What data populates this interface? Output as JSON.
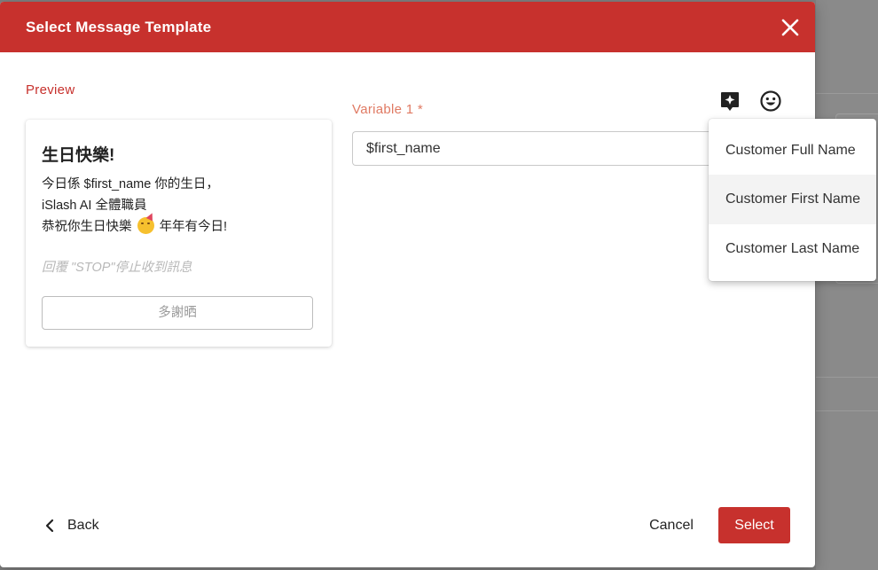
{
  "dialog": {
    "title": "Select Message Template"
  },
  "preview": {
    "label": "Preview",
    "card": {
      "title": "生日快樂!",
      "line1": "今日係 $first_name 你的生日，",
      "line2": "iSlash AI 全體職員",
      "line3_before": "恭祝你生日快樂",
      "line3_emoji": "partying-face",
      "line3_after": "年年有今日!",
      "footer_note": "回覆 \"STOP\"停止收到訊息",
      "button_label": "多謝晒"
    }
  },
  "variable": {
    "label": "Variable 1 *",
    "value": "$first_name"
  },
  "dropdown": {
    "items": [
      {
        "label": "Customer Full Name"
      },
      {
        "label": "Customer First Name"
      },
      {
        "label": "Customer Last Name"
      }
    ],
    "highlighted_index": 1
  },
  "footer": {
    "back_label": "Back",
    "cancel_label": "Cancel",
    "select_label": "Select"
  },
  "colors": {
    "brand": "#c7312d",
    "variable_label": "#e07a63"
  }
}
